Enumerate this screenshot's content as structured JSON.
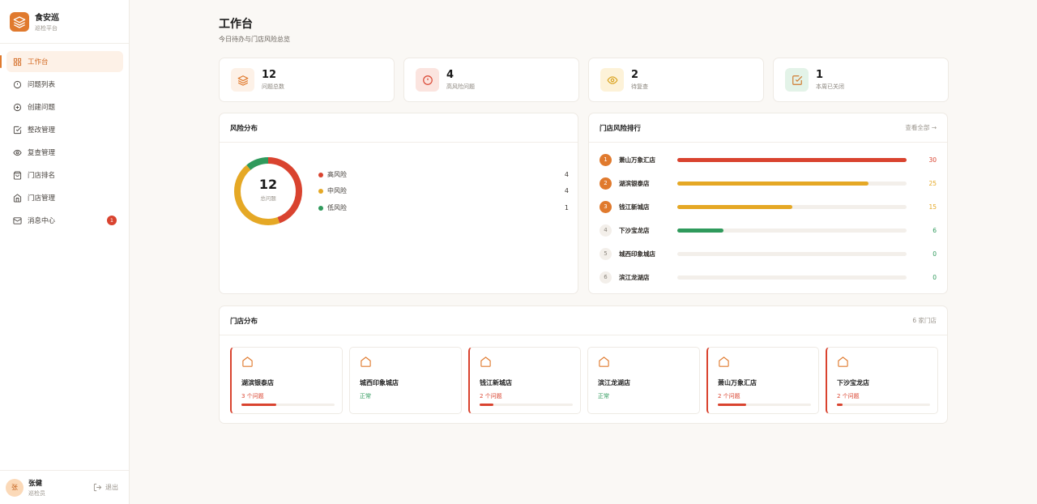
{
  "brand": {
    "name": "食安巡",
    "subtitle": "巡检平台"
  },
  "nav": [
    {
      "label": "工作台",
      "icon": "dashboard-icon",
      "active": true
    },
    {
      "label": "问题列表",
      "icon": "alert-circle-icon"
    },
    {
      "label": "创建问题",
      "icon": "plus-circle-icon"
    },
    {
      "label": "整改管理",
      "icon": "check-square-icon"
    },
    {
      "label": "复查管理",
      "icon": "eye-icon"
    },
    {
      "label": "门店排名",
      "icon": "shopping-bag-icon"
    },
    {
      "label": "门店管理",
      "icon": "home-icon"
    },
    {
      "label": "消息中心",
      "icon": "mail-icon",
      "badge": "1"
    }
  ],
  "user": {
    "avatar": "张",
    "name": "张健",
    "role": "巡检员",
    "logout": "退出"
  },
  "page": {
    "title": "工作台",
    "subtitle": "今日待办与门店风险总览"
  },
  "stats": [
    {
      "value": "12",
      "label": "问题总数",
      "icon": "layers-icon",
      "bg": "#fdf1e7",
      "color": "#e07a2e"
    },
    {
      "value": "4",
      "label": "高风险问题",
      "icon": "alert-circle-icon",
      "bg": "#fbe4df",
      "color": "#d9432f"
    },
    {
      "value": "2",
      "label": "待复查",
      "icon": "eye-icon",
      "bg": "#fdf2d8",
      "color": "#d9a21d"
    },
    {
      "value": "1",
      "label": "本周已关闭",
      "icon": "check-square-icon",
      "bg": "#e3f3e8",
      "color": "#2f9a5c"
    }
  ],
  "risk": {
    "title": "风险分布",
    "total": "12",
    "total_label": "总问题",
    "items": [
      {
        "label": "高风险",
        "value": 4,
        "color": "#d9432f"
      },
      {
        "label": "中风险",
        "value": 4,
        "color": "#e5a825"
      },
      {
        "label": "低风险",
        "value": 1,
        "color": "#2f9a5c"
      }
    ]
  },
  "ranking": {
    "title": "门店风险排行",
    "more": "查看全部 →",
    "max": 30,
    "items": [
      {
        "rank": "1",
        "name": "萧山万象汇店",
        "score": 30,
        "color": "#d9432f"
      },
      {
        "rank": "2",
        "name": "湖滨银泰店",
        "score": 25,
        "color": "#e5a825"
      },
      {
        "rank": "3",
        "name": "钱江新城店",
        "score": 15,
        "color": "#e5a825"
      },
      {
        "rank": "4",
        "name": "下沙宝龙店",
        "score": 6,
        "color": "#2f9a5c"
      },
      {
        "rank": "5",
        "name": "城西印象城店",
        "score": 0,
        "color": "#2f9a5c"
      },
      {
        "rank": "6",
        "name": "滨江龙湖店",
        "score": 0,
        "color": "#2f9a5c"
      }
    ]
  },
  "stores": {
    "title": "门店分布",
    "count": "6 家门店",
    "items": [
      {
        "name": "湖滨银泰店",
        "status": "3 个问题",
        "alert": true,
        "level": 0.37
      },
      {
        "name": "城西印象城店",
        "status": "正常",
        "alert": false,
        "level": 0
      },
      {
        "name": "钱江新城店",
        "status": "2 个问题",
        "alert": true,
        "level": 0.15
      },
      {
        "name": "滨江龙湖店",
        "status": "正常",
        "alert": false,
        "level": 0
      },
      {
        "name": "萧山万象汇店",
        "status": "2 个问题",
        "alert": true,
        "level": 0.3
      },
      {
        "name": "下沙宝龙店",
        "status": "2 个问题",
        "alert": true,
        "level": 0.06
      }
    ]
  },
  "colors": {
    "accent": "#e07a2e",
    "danger": "#d9432f",
    "success": "#2f9a5c",
    "warning": "#e5a825"
  }
}
